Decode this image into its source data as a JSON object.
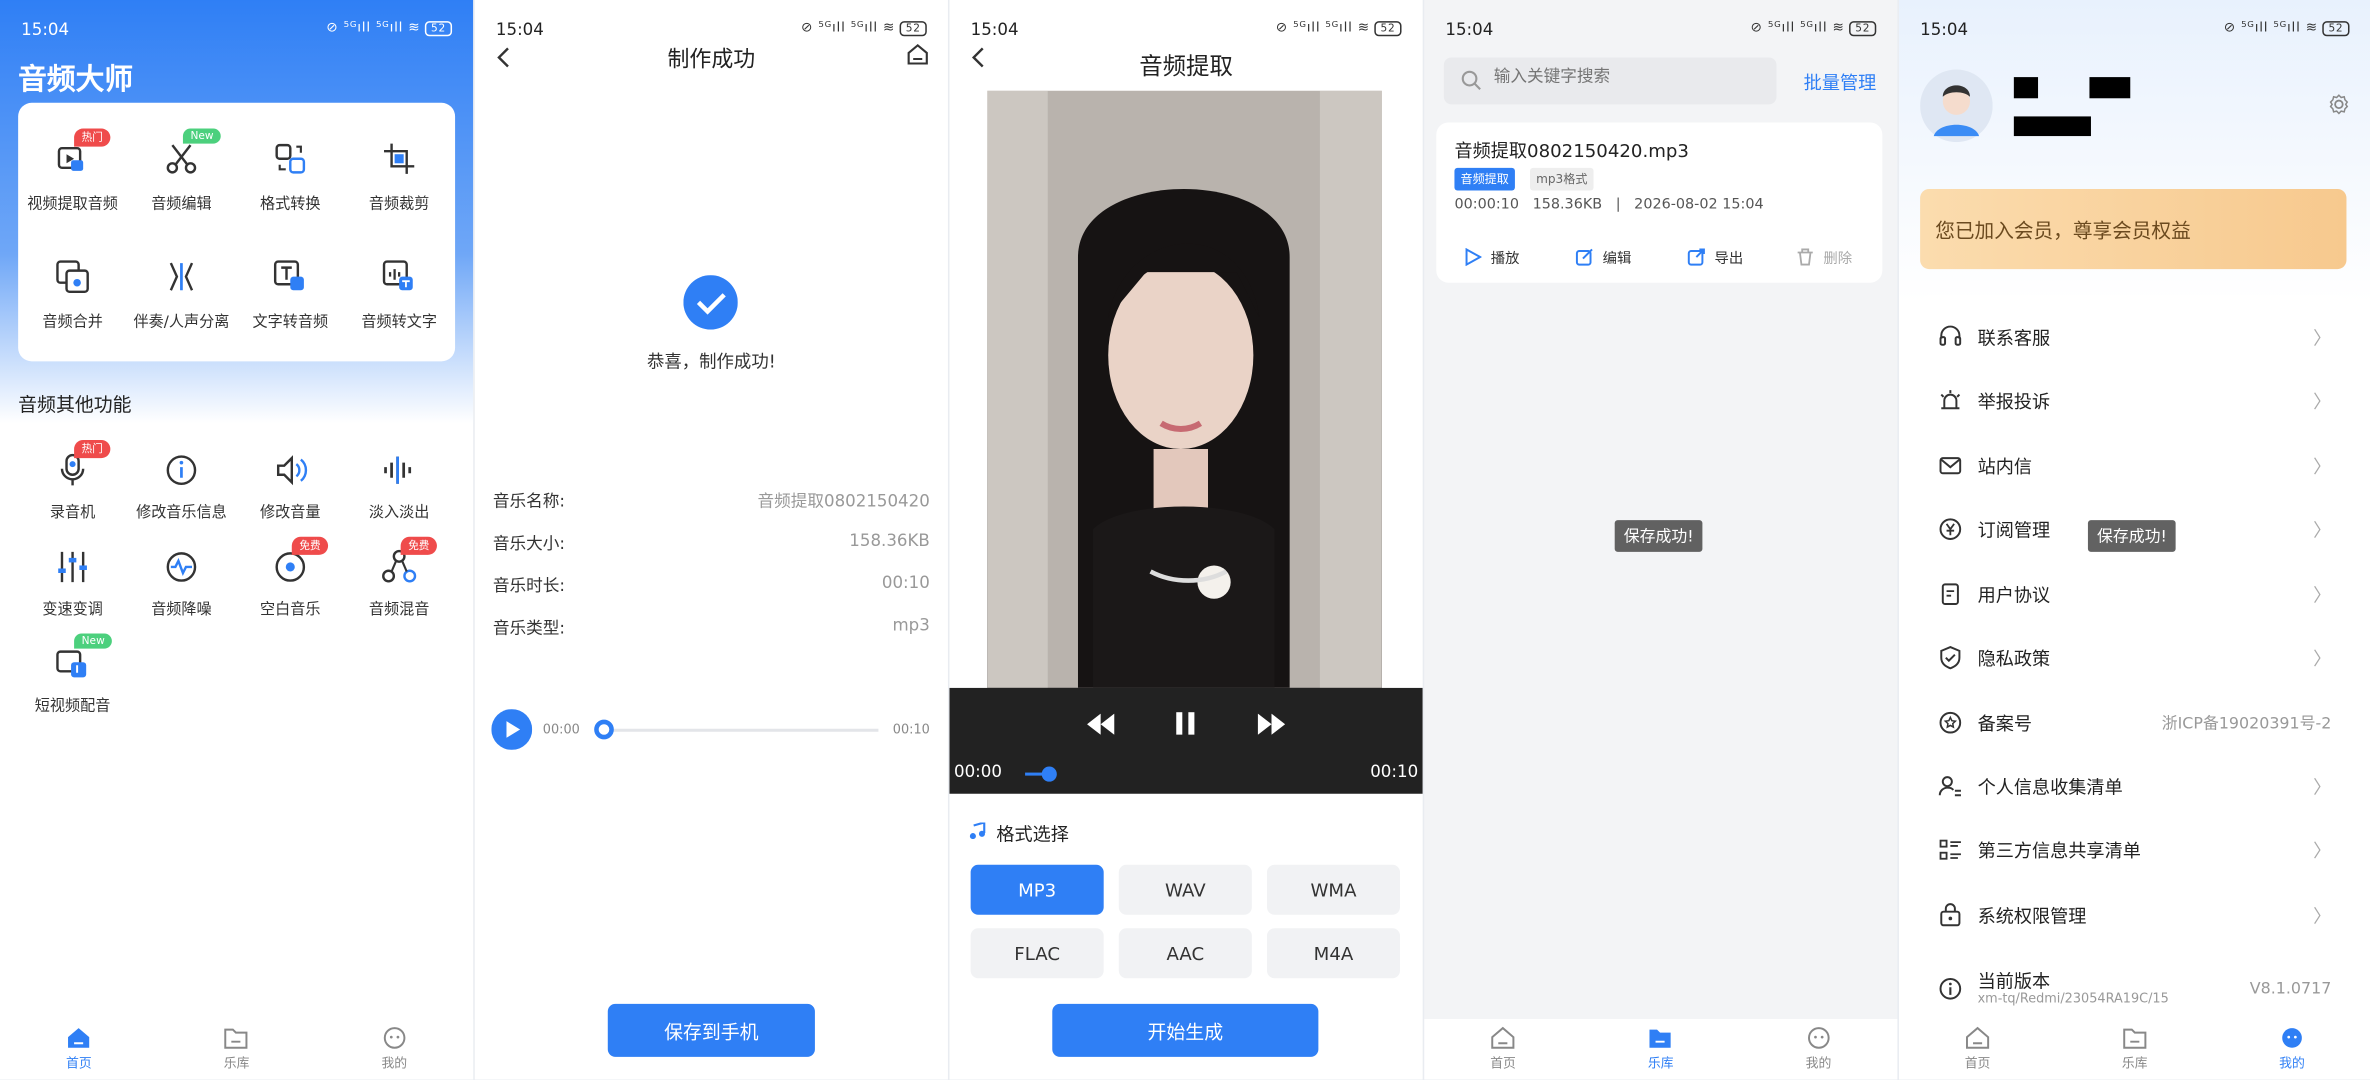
{
  "status": {
    "time": "15:04",
    "signals": "⊘ ⁵ᴳıll ⁵ᴳıll ≋",
    "battery": "52"
  },
  "home": {
    "title": "音频大师",
    "features": [
      {
        "label": "视频提取音频",
        "badge": "热门",
        "icon": "video-extract-icon"
      },
      {
        "label": "音频编辑",
        "badge": "New",
        "icon": "scissors-icon"
      },
      {
        "label": "格式转换",
        "badge": "",
        "icon": "convert-icon"
      },
      {
        "label": "音频裁剪",
        "badge": "",
        "icon": "crop-icon"
      },
      {
        "label": "音频合并",
        "badge": "",
        "icon": "merge-icon"
      },
      {
        "label": "伴奏/人声分离",
        "badge": "",
        "icon": "separate-icon"
      },
      {
        "label": "文字转音频",
        "badge": "",
        "icon": "text-to-audio-icon"
      },
      {
        "label": "音频转文字",
        "badge": "",
        "icon": "audio-to-text-icon"
      }
    ],
    "other_title": "音频其他功能",
    "others": [
      {
        "label": "录音机",
        "badge": "热门",
        "icon": "microphone-icon"
      },
      {
        "label": "修改音乐信息",
        "badge": "",
        "icon": "info-icon"
      },
      {
        "label": "修改音量",
        "badge": "",
        "icon": "volume-icon"
      },
      {
        "label": "淡入淡出",
        "badge": "",
        "icon": "waveform-icon"
      },
      {
        "label": "变速变调",
        "badge": "",
        "icon": "sliders-icon"
      },
      {
        "label": "音频降噪",
        "badge": "",
        "icon": "denoise-icon"
      },
      {
        "label": "空白音乐",
        "badge": "免费",
        "icon": "disc-icon"
      },
      {
        "label": "音频混音",
        "badge": "免费",
        "icon": "mix-icon"
      },
      {
        "label": "短视频配音",
        "badge": "New",
        "icon": "video-dub-icon"
      }
    ]
  },
  "tabs": [
    {
      "label": "首页"
    },
    {
      "label": "乐库"
    },
    {
      "label": "我的"
    }
  ],
  "success": {
    "title": "制作成功",
    "message": "恭喜，制作成功!",
    "rows": [
      {
        "k": "音乐名称:",
        "v": "音频提取0802150420"
      },
      {
        "k": "音乐大小:",
        "v": "158.36KB"
      },
      {
        "k": "音乐时长:",
        "v": "00:10"
      },
      {
        "k": "音乐类型:",
        "v": "mp3"
      }
    ],
    "player": {
      "current": "00:00",
      "total": "00:10",
      "progress": 0
    },
    "save_label": "保存到手机"
  },
  "extract": {
    "title": "音频提取",
    "video": {
      "current": "00:00",
      "total": "00:10",
      "progress": 0.05
    },
    "format_title": "格式选择",
    "formats": [
      "MP3",
      "WAV",
      "WMA",
      "FLAC",
      "AAC",
      "M4A"
    ],
    "selected": "MP3",
    "start_label": "开始生成"
  },
  "library": {
    "search_placeholder": "输入关键字搜索",
    "batch_label": "批量管理",
    "item": {
      "name": "音频提取0802150420.mp3",
      "tag1": "音频提取",
      "tag2": "mp3格式",
      "duration": "00:00:10",
      "size": "158.36KB",
      "sep": "|",
      "date": "2026-08-02 15:04",
      "actions": {
        "play": "播放",
        "edit": "编辑",
        "export": "导出",
        "delete": "删除"
      }
    },
    "toast": "保存成功!"
  },
  "profile": {
    "vip_text": "您已加入会员，尊享会员权益",
    "toast": "保存成功!",
    "menu": [
      {
        "label": "联系客服",
        "value": "",
        "icon": "headset-icon"
      },
      {
        "label": "举报投诉",
        "value": "",
        "icon": "alarm-icon"
      },
      {
        "label": "站内信",
        "value": "",
        "icon": "mail-icon"
      },
      {
        "label": "订阅管理",
        "value": "",
        "icon": "yen-icon"
      },
      {
        "label": "用户协议",
        "value": "",
        "icon": "document-icon"
      },
      {
        "label": "隐私政策",
        "value": "",
        "icon": "shield-icon"
      },
      {
        "label": "备案号",
        "value": "浙ICP备19020391号-2",
        "icon": "badge-icon"
      },
      {
        "label": "个人信息收集清单",
        "value": "",
        "icon": "person-list-icon"
      },
      {
        "label": "第三方信息共享清单",
        "value": "",
        "icon": "list-icon"
      },
      {
        "label": "系统权限管理",
        "value": "",
        "icon": "lock-icon"
      },
      {
        "label": "当前版本",
        "value": "V8.1.0717",
        "sub": "xm-tq/Redmi/23054RA19C/15",
        "icon": "info-icon"
      }
    ]
  },
  "colors": {
    "accent": "#2f7ff5",
    "hot": "#ef4b4b",
    "new": "#4cd07d",
    "vip": "#f7c98e"
  }
}
